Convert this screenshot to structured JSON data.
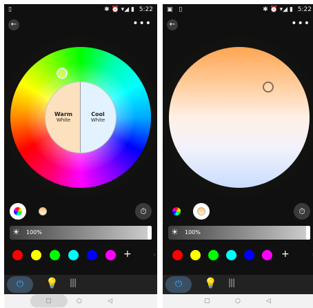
{
  "status": {
    "left_icons_a": "▯",
    "left_icons_b": "▣ ▯",
    "right_icons": "✱ ⏰ ▾◢ ▮",
    "time": "5:22"
  },
  "topbar": {
    "back": "←",
    "more": "•••"
  },
  "color_temp": {
    "warm_title": "Warm",
    "warm_sub": "White",
    "cool_title": "Cool",
    "cool_sub": "White"
  },
  "brightness": {
    "icon": "☀",
    "value": "100%",
    "level_fraction": 1.0
  },
  "controls": {
    "timer_icon": "⏱",
    "add": "+",
    "more_arrow": "›"
  },
  "swatches": [
    "#ff0000",
    "#ffff00",
    "#00ff00",
    "#00ffff",
    "#0000ff",
    "#ff00ff"
  ],
  "nav": {
    "power_icon": "⏻",
    "bulb_icon": "💡",
    "wave_icon": "|||"
  },
  "sysnav": {
    "back": "◁",
    "home": "○",
    "recent": "▢"
  },
  "accent_blue": "#3fa9ff"
}
